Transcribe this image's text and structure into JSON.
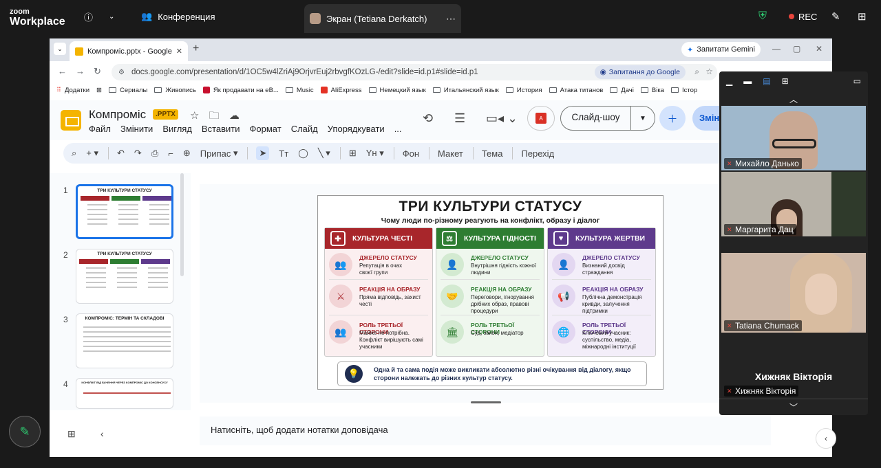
{
  "zoom": {
    "logo_top": "zoom",
    "logo_bottom": "Workplace",
    "meeting_tab": "Конференция",
    "screen_tab": "Экран (Tetiana Derkatch)",
    "rec_label": "REC"
  },
  "browser": {
    "tab_title": "Компроміс.pptx - Google Пре",
    "gemini_label": "Запитати Gemini",
    "url": "docs.google.com/presentation/d/1OC5w4lZriAj9OrjvrEuj2rbvgfKOzLG-/edit?slide=id.p1#slide=id.p1",
    "omni_action": "Запитання до Google",
    "bookmarks": [
      "Додатки",
      "Сериалы",
      "Живопись",
      "Як продавати на еВ...",
      "Music",
      "AliExpress",
      "Немецкий язык",
      "Итальянский язык",
      "История",
      "Атака титанов",
      "Дачі",
      "Віка",
      "Істор"
    ]
  },
  "slides_app": {
    "doc_title": "Компроміс",
    "badge": ".PPTX",
    "menu": [
      "Файл",
      "Змінити",
      "Вигляд",
      "Вставити",
      "Формат",
      "Слайд",
      "Упорядкувати",
      "..."
    ],
    "slideshow_label": "Слайд-шоу",
    "share_label": "Зміни",
    "toolbar": {
      "zoom_label": "Припас",
      "bg": "Фон",
      "layout": "Макет",
      "theme": "Тема",
      "transition": "Перехід"
    },
    "notes_placeholder": "Натисніть, щоб додати нотатки доповідача",
    "thumbnails": [
      {
        "num": "1",
        "title": "ТРИ КУЛЬТУРИ СТАТУСУ"
      },
      {
        "num": "2",
        "title": "ТРИ КУЛЬТУРИ СТАТУСУ"
      },
      {
        "num": "3",
        "title": "КОМПРОМІС: ТЕРМІН ТА СКЛАДОВІ"
      },
      {
        "num": "4",
        "title": "КОНФЛІКТ ВІД БАЧЕННЯ ЧЕРЕЗ КОМПРОМІС ДО КОНСЕНСУСУ"
      }
    ]
  },
  "slide": {
    "title": "ТРИ КУЛЬТУРИ СТАТУСУ",
    "subtitle": "Чому люди по-різному реагують на конфлікт, образу і діалог",
    "columns": [
      {
        "header": "КУЛЬТУРА ЧЕСТІ",
        "color": "#a8262b",
        "bg": "#fbeff0",
        "rows": [
          {
            "h": "ДЖЕРЕЛО СТАТУСУ",
            "t": "Репутація в очах своєї групи"
          },
          {
            "h": "РЕАКЦІЯ НА ОБРАЗУ",
            "t": "Пряма відповідь, захист честі"
          },
          {
            "h": "РОЛЬ ТРЕТЬОЇ СТОРОНИ",
            "t": "Майже не потрібна. Конфлікт вирішують самі учасники"
          }
        ]
      },
      {
        "header": "КУЛЬТУРА ГІДНОСТІ",
        "color": "#2e7d32",
        "bg": "#eff7ee",
        "rows": [
          {
            "h": "ДЖЕРЕЛО СТАТУСУ",
            "t": "Внутрішня гідність кожної людини"
          },
          {
            "h": "РЕАКЦІЯ НА ОБРАЗУ",
            "t": "Переговори, ігнорування дрібних образ, правові процедури"
          },
          {
            "h": "РОЛЬ ТРЕТЬОЇ СТОРОНИ",
            "t": "Суд, закон, медіатор"
          }
        ]
      },
      {
        "header": "КУЛЬТУРА ЖЕРТВИ",
        "color": "#5e3a8c",
        "bg": "#f3eef9",
        "rows": [
          {
            "h": "ДЖЕРЕЛО СТАТУСУ",
            "t": "Визнаний досвід страждання"
          },
          {
            "h": "РЕАКЦІЯ НА ОБРАЗУ",
            "t": "Публічна демонстрація кривди, залучення підтримки"
          },
          {
            "h": "РОЛЬ ТРЕТЬОЇ СТОРОНИ",
            "t": "Ключовий учасник: суспільство, медіа, міжнародні інституції"
          }
        ]
      }
    ],
    "footer": "Одна й та сама подія може викликати абсолютно різні очікування від діалогу, якщо сторони належать до різних культур статусу."
  },
  "participants": [
    {
      "name": "Михайло Данько"
    },
    {
      "name": "Маргарита Дац"
    },
    {
      "name": "Tatiana Chumack"
    },
    {
      "name": "Хижняк Вікторія"
    }
  ],
  "participants_big_name": "Хижняк Вікторія",
  "colors": {
    "accent": "#1a73e8",
    "honor": "#a8262b",
    "dignity": "#2e7d32",
    "victim": "#5e3a8c",
    "rec": "#e8453c"
  }
}
